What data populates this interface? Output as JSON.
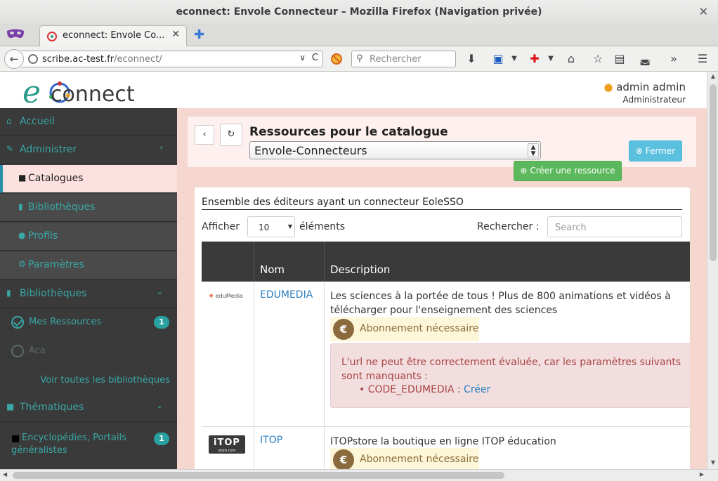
{
  "window": {
    "title": "econnect: Envole Connecteur – Mozilla Firefox (Navigation privée)",
    "close": "✕"
  },
  "tabs": {
    "active_title": "econnect: Envole Co...",
    "close": "✕",
    "new_tab": "✚"
  },
  "navbar": {
    "back": "←",
    "url_host": "scribe.ac-test.fr",
    "url_path": "/econnect/",
    "url_dropdown": "∨",
    "url_reload": "C",
    "search_placeholder": "Rechercher",
    "icons": [
      "download-icon",
      "save-icon",
      "addon-icon",
      "home-icon",
      "bookmark-star-icon",
      "reading-list-icon",
      "pocket-icon",
      "overflow-icon",
      "menu-icon"
    ],
    "overflow": "»",
    "menu": "☰"
  },
  "app": {
    "logo_text": "connect",
    "logo_letter": "e",
    "user_name": "admin admin",
    "user_role": "Administrateur"
  },
  "sidebar": {
    "accueil": "Accueil",
    "administrer": "Administrer",
    "catalogues": "Catalogues",
    "bibliotheques_sub": "Bibliothèques",
    "profils": "Profils",
    "parametres": "Paramètres",
    "bibliotheques": "Bibliothèques",
    "mes_ressources": "Mes Ressources",
    "mes_ressources_count": "1",
    "aca": "Aca",
    "voir_toutes": "Voir toutes les bibliothèques",
    "thematiques": "Thématiques",
    "encyclopedies_line1": "Encyclopédies, Portails",
    "encyclopedies_line2": "généralistes",
    "encyclopedies_count": "1",
    "chevron_left": "‹",
    "chevron_down": "⌄"
  },
  "main": {
    "back_btn": "‹",
    "refresh_btn": "↻",
    "title": "Ressources pour le catalogue",
    "catalog_select": "Envole-Connecteurs",
    "fermer": "Fermer",
    "creer_ressource": "Créer une ressource"
  },
  "table": {
    "caption": "Ensemble des éditeurs ayant un connecteur EoleSSO",
    "afficher": "Afficher",
    "length_value": "10",
    "elements": "éléments",
    "rechercher": "Rechercher :",
    "search_placeholder": "Search",
    "col_nom": "Nom",
    "col_description": "Description",
    "rows": [
      {
        "logo": "eduMedia",
        "name": "EDUMEDIA",
        "description": "Les sciences à la portée de tous ! Plus de 800 animations et vidéos à télécharger pour l'enseignement des sciences",
        "abonnement": "Abonnement nécessaire",
        "alert_msg": "L'url ne peut être correctement évaluée, car les paramètres suivants sont manquants :",
        "alert_param": "CODE_EDUMEDIA :",
        "alert_link": "Créer"
      },
      {
        "logo": "iTOP",
        "logo_sub": "store.com",
        "name": "ITOP",
        "description": "ITOPstore la boutique en ligne ITOP éducation",
        "abonnement": "Abonnement nécessaire"
      }
    ]
  },
  "colors": {
    "sidebar_bg": "#3a3a3a",
    "accent_teal": "#3aa6a6",
    "main_bg": "#f5d7d0",
    "btn_info": "#5bc0de",
    "btn_success": "#5cb85c"
  }
}
